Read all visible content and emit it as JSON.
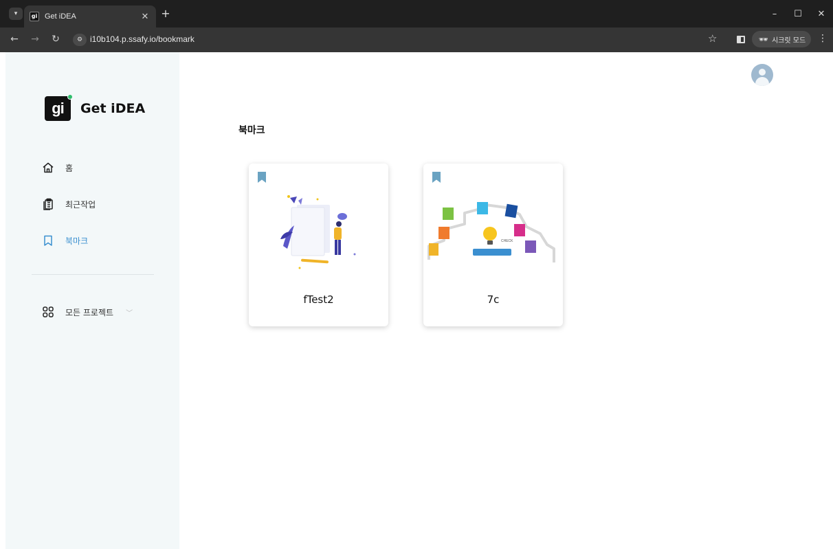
{
  "browser": {
    "tab_title": "Get iDEA",
    "favicon_text": "gi",
    "url": "i10b104.p.ssafy.io/bookmark",
    "incognito_label": "시크릿 모드",
    "icons": [
      "chevron-down-icon",
      "close-icon",
      "plus-icon",
      "minimize-icon",
      "maximize-icon",
      "close-window-icon",
      "back-icon",
      "forward-icon",
      "reload-icon",
      "site-info-icon",
      "star-icon",
      "side-panel-icon",
      "incognito-icon",
      "kebab-menu-icon"
    ]
  },
  "logo": {
    "mark": "gi",
    "text": "Get iDEA"
  },
  "sidebar": {
    "items": [
      {
        "label": "홈",
        "icon": "home-icon"
      },
      {
        "label": "최근작업",
        "icon": "clipboard-icon"
      },
      {
        "label": "북마크",
        "icon": "bookmark-icon",
        "active": true
      },
      {
        "label": "모든 프로젝트",
        "icon": "grid-icon"
      }
    ],
    "active_color": "#3a8fd0"
  },
  "main": {
    "title": "북마크",
    "cards": [
      {
        "name": "fTest2",
        "thumbnail": "person-with-document-illustration"
      },
      {
        "name": "7c",
        "thumbnail": "idea-lightbulb-cards-illustration"
      }
    ]
  },
  "colors": {
    "sidebar_bg": "#f3f8f9",
    "bookmark_icon": "#6aa3c2",
    "avatar_bg": "#9fb9cf"
  }
}
